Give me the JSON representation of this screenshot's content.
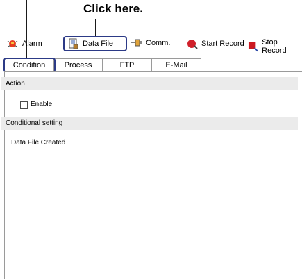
{
  "callout": {
    "text": "Click here."
  },
  "toolbar": {
    "alarm_label": "Alarm",
    "data_file_label": "Data File",
    "comm_label": "Comm.",
    "start_record_label": "Start Record",
    "stop_record_label": "Stop Record"
  },
  "tabs": [
    {
      "label": "Condition"
    },
    {
      "label": "Process"
    },
    {
      "label": "FTP"
    },
    {
      "label": "E-Mail"
    }
  ],
  "sections": {
    "action_title": "Action",
    "enable_label": "Enable",
    "conditional_title": "Conditional setting",
    "condition_value": "Data File Created"
  },
  "colors": {
    "annotation_box": "#2c3a86",
    "section_header": "#ebebeb",
    "start_record_red": "#d0202a",
    "stop_record_red": "#cc1820"
  },
  "icons": {
    "alarm": "alarm-bell-icon",
    "data_file": "data-file-icon",
    "comm": "comm-connector-icon",
    "start_record": "start-record-icon",
    "stop_record": "stop-record-icon"
  }
}
